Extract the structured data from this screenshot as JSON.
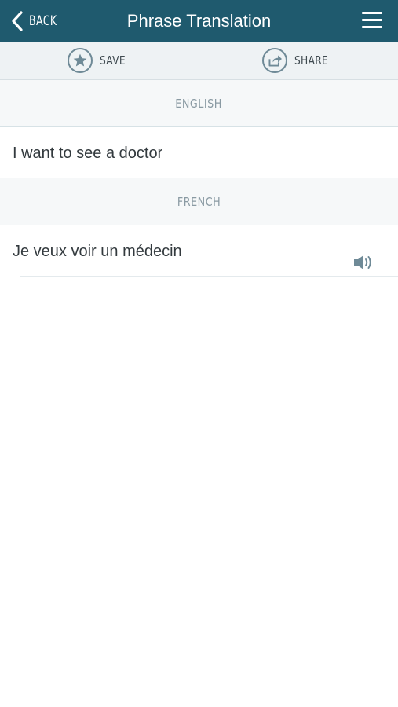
{
  "header": {
    "back_label": "BACK",
    "title": "Phrase Translation",
    "menu_icon": "hamburger-menu-icon"
  },
  "toolbar": {
    "save_label": "SAVE",
    "save_icon": "star-icon",
    "share_label": "SHARE",
    "share_icon": "share-icon"
  },
  "source": {
    "language": "ENGLISH",
    "phrase": "I want to see a doctor"
  },
  "target": {
    "language": "FRENCH",
    "phrase": "Je veux voir un médecin",
    "audio_icon": "speaker-icon"
  },
  "colors": {
    "header_bg": "#1f5a6e",
    "toolbar_bg": "#eef2f4",
    "icon_stroke": "#6f8a97",
    "language_label": "#8a9aa3",
    "phrase_text": "#333a3e"
  }
}
